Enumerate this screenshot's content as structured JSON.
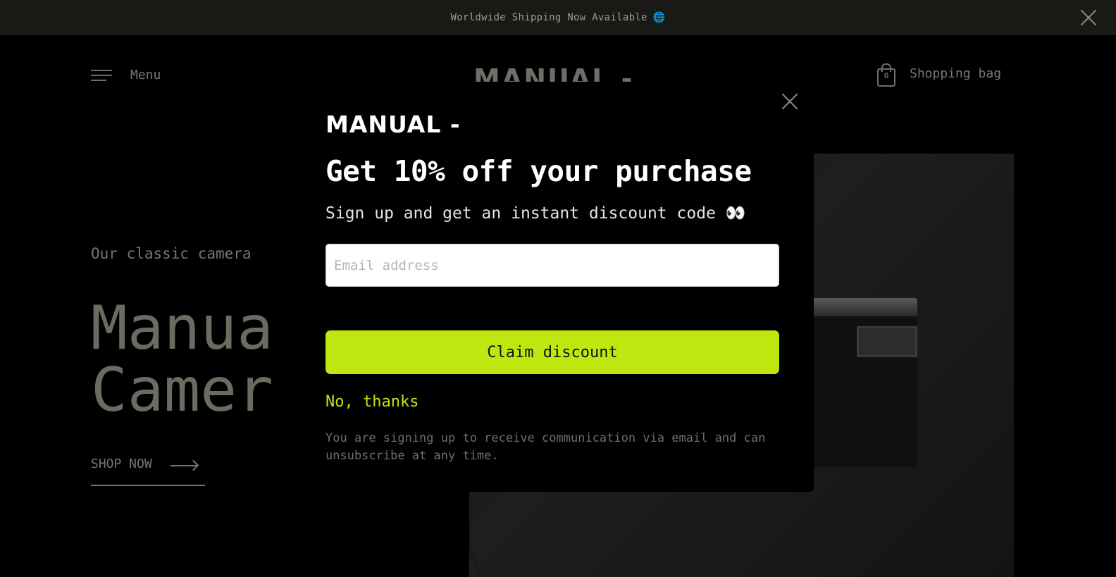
{
  "announcement": {
    "text": "Worldwide Shipping Now Available",
    "globe_icon": "🌐"
  },
  "header": {
    "menu_label": "Menu",
    "logo": "MANUAL -",
    "bag_label": "Shopping bag",
    "bag_count": "0"
  },
  "hero": {
    "subtitle": "Our classic camera",
    "title_line1": "Manua",
    "title_line2": "Camer",
    "cta": "SHOP NOW"
  },
  "modal": {
    "logo": "MANUAL -",
    "title": "Get 10% off your purchase",
    "subtitle": "Sign up and get an instant discount code",
    "subtitle_emoji": "👀",
    "email_placeholder": "Email address",
    "claim_label": "Claim discount",
    "decline_label": "No, thanks",
    "disclaimer": "You are signing up to receive communication via email and can unsubscribe at any time."
  },
  "colors": {
    "accent": "#bde70f",
    "announcement_bg": "#191915",
    "background": "#000000"
  }
}
